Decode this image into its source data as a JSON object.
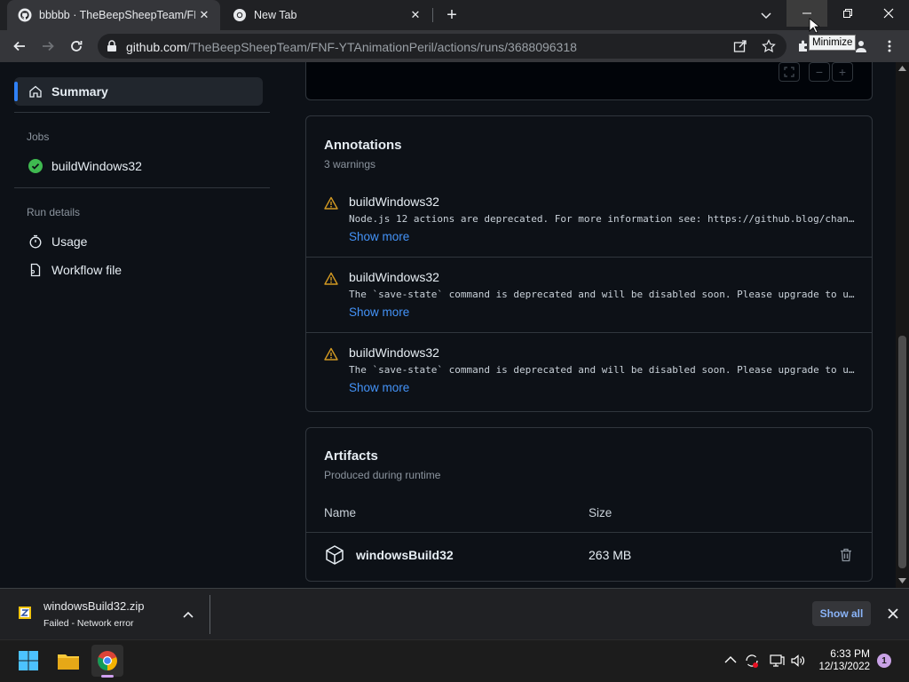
{
  "browser": {
    "tabs": [
      {
        "title": "bbbbb · TheBeepSheepTeam/FNF",
        "icon": "github-icon",
        "active": true
      },
      {
        "title": "New Tab",
        "icon": "chrome-icon",
        "active": false
      }
    ],
    "url_host": "github.com",
    "url_path": "/TheBeepSheepTeam/FNF-YTAnimationPeril/actions/runs/3688096318",
    "tooltip": "Minimize"
  },
  "sidebar": {
    "summary": "Summary",
    "jobs_heading": "Jobs",
    "job": "buildWindows32",
    "run_details_heading": "Run details",
    "usage": "Usage",
    "workflow_file": "Workflow file"
  },
  "annotations": {
    "title": "Annotations",
    "subtitle": "3 warnings",
    "items": [
      {
        "name": "buildWindows32",
        "message": "Node.js 12 actions are deprecated. For more information see: https://github.blog/chan…",
        "more": "Show more"
      },
      {
        "name": "buildWindows32",
        "message": "The `save-state` command is deprecated and will be disabled soon. Please upgrade to u…",
        "more": "Show more"
      },
      {
        "name": "buildWindows32",
        "message": "The `save-state` command is deprecated and will be disabled soon. Please upgrade to u…",
        "more": "Show more"
      }
    ]
  },
  "artifacts": {
    "title": "Artifacts",
    "subtitle": "Produced during runtime",
    "col_name": "Name",
    "col_size": "Size",
    "rows": [
      {
        "name": "windowsBuild32",
        "size": "263 MB"
      }
    ]
  },
  "download": {
    "filename": "windowsBuild32.zip",
    "status": "Failed - Network error",
    "show_all": "Show all"
  },
  "taskbar": {
    "time": "6:33 PM",
    "date": "12/13/2022",
    "notifications": "1"
  },
  "colors": {
    "accent_blue": "#2f81f7",
    "link": "#4493f8",
    "warning": "#d29922",
    "success": "#3fb950"
  }
}
